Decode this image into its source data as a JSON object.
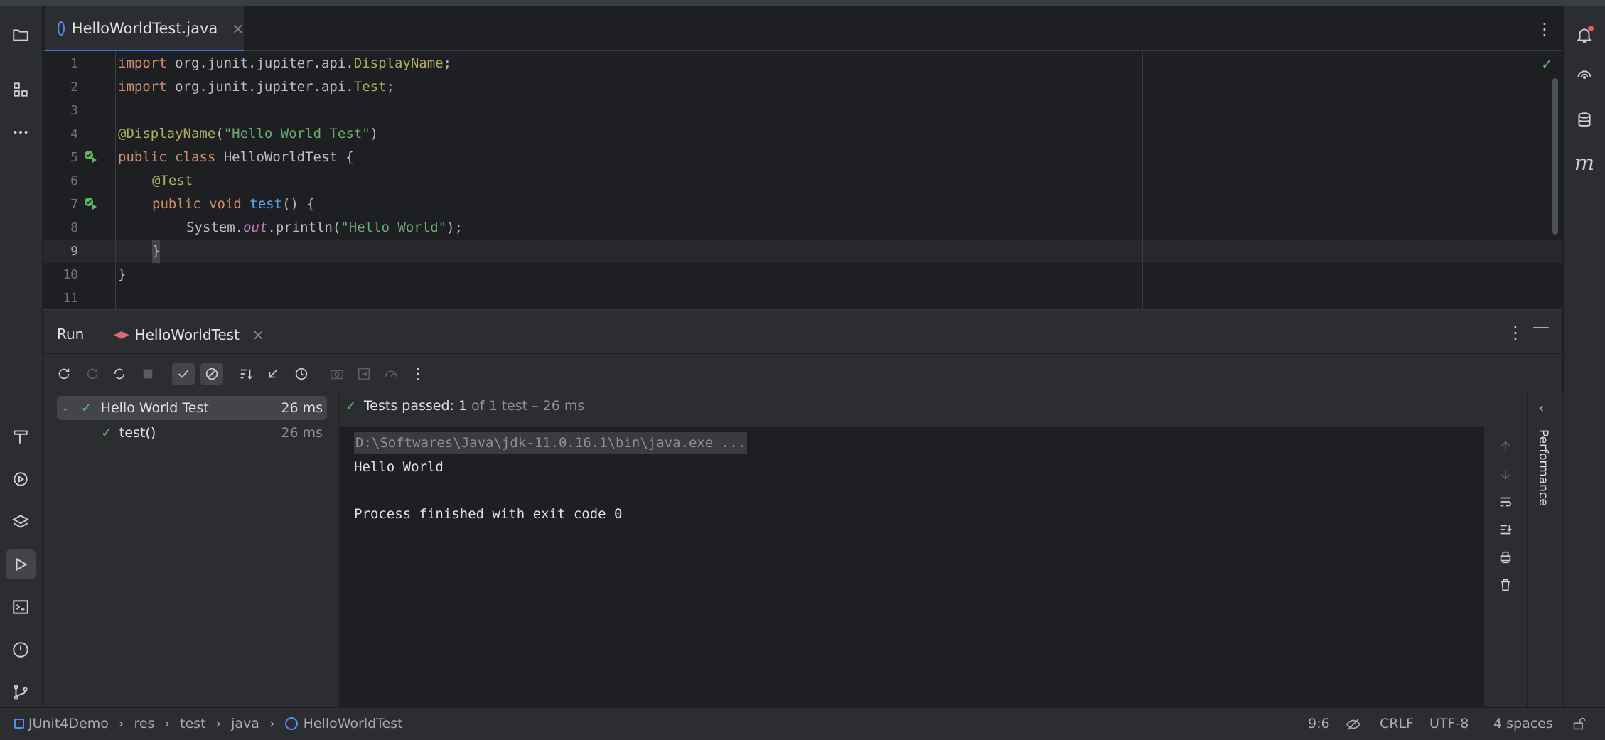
{
  "editor": {
    "tab_label": "HelloWorldTest.java",
    "close_glyph": "×",
    "lines": [
      {
        "num": "1"
      },
      {
        "num": "2"
      },
      {
        "num": "3"
      },
      {
        "num": "4"
      },
      {
        "num": "5"
      },
      {
        "num": "6"
      },
      {
        "num": "7"
      },
      {
        "num": "8"
      },
      {
        "num": "9"
      },
      {
        "num": "10"
      },
      {
        "num": "11"
      }
    ],
    "code": {
      "l1_kw": "import",
      "l1_pkg": " org.junit.jupiter.api.",
      "l1_cls": "DisplayName",
      "l1_end": ";",
      "l2_kw": "import",
      "l2_pkg": " org.junit.jupiter.api.",
      "l2_cls": "Test",
      "l2_end": ";",
      "l4_ann": "@DisplayName",
      "l4_open": "(",
      "l4_str": "\"Hello World Test\"",
      "l4_close": ")",
      "l5_kw": "public class",
      "l5_name": " HelloWorldTest {",
      "l6_ann": "@Test",
      "l7_kw": "public void",
      "l7_sp": " ",
      "l7_fn": "test",
      "l7_rest": "() {",
      "l8_sys": "System.",
      "l8_out": "out",
      "l8_mid": ".println(",
      "l8_str": "\"Hello World\"",
      "l8_end": ");",
      "l9": "}",
      "l10": "}"
    },
    "status_colors": {
      "keyword": "#cf8e6d",
      "annotation": "#b3ae60",
      "string": "#6aab73",
      "function": "#56a8f5"
    }
  },
  "run_panel": {
    "title": "Run",
    "tab_label": "HelloWorldTest",
    "close_glyph": "×",
    "tree": [
      {
        "label": "Hello World Test",
        "time": "26 ms"
      },
      {
        "label": "test()",
        "time": "26 ms"
      }
    ],
    "summary_bold": "Tests passed: 1",
    "summary_rest": " of 1 test – 26 ms",
    "console": {
      "cmd": "D:\\Softwares\\Java\\jdk-11.0.16.1\\bin\\java.exe ...",
      "out": "Hello World",
      "exit": "Process finished with exit code 0"
    },
    "perf_label": "Performance"
  },
  "status_bar": {
    "breadcrumb": [
      "JUnit4Demo",
      "res",
      "test",
      "java",
      "HelloWorldTest"
    ],
    "separator": "›",
    "position": "9:6",
    "line_sep": "CRLF",
    "encoding": "UTF-8",
    "indent": "4 spaces"
  },
  "colors": {
    "accent": "#3574f0",
    "pass": "#5fb865",
    "bg": "#1e1f22",
    "panel": "#2b2d30"
  }
}
